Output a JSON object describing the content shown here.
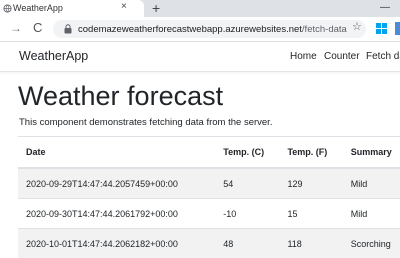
{
  "browser": {
    "tab_title": "WeatherApp",
    "tab_close": "×",
    "new_tab": "+",
    "window_control": "—",
    "url_host": "codemazeweatherforecastwebapp.azurewebsites.net",
    "url_path": "/fetch-data",
    "nav_forward": "→",
    "nav_reload": "C",
    "bookmark_star": "☆"
  },
  "navbar": {
    "brand": "WeatherApp",
    "links": [
      "Home",
      "Counter",
      "Fetch da"
    ]
  },
  "main": {
    "title": "Weather forecast",
    "description": "This component demonstrates fetching data from the server."
  },
  "table": {
    "headers": [
      "Date",
      "Temp. (C)",
      "Temp. (F)",
      "Summary"
    ],
    "rows": [
      [
        "2020-09-29T14:47:44.2057459+00:00",
        "54",
        "129",
        "Mild"
      ],
      [
        "2020-09-30T14:47:44.2061792+00:00",
        "-10",
        "15",
        "Mild"
      ],
      [
        "2020-10-01T14:47:44.2062182+00:00",
        "48",
        "118",
        "Scorching"
      ]
    ]
  },
  "colors": {
    "tabbar": "#dee1e6",
    "omnibox": "#f1f3f4",
    "stripe": "#f2f2f2",
    "border": "#dee2e6"
  }
}
